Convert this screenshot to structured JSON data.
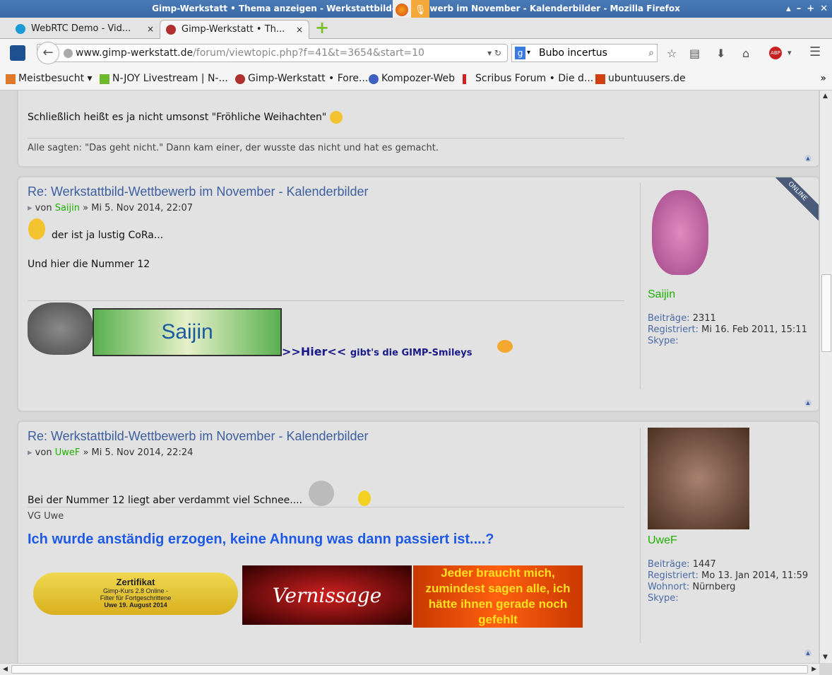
{
  "window": {
    "title": "Gimp-Werkstatt • Thema anzeigen - Werkstattbild-Wettbewerb im November - Kalenderbilder - Mozilla Firefox",
    "controls": [
      "▴",
      "–",
      "+",
      "✕"
    ]
  },
  "tabs": [
    {
      "label": "WebRTC Demo - Vid...",
      "close": "×"
    },
    {
      "label": "Gimp-Werkstatt • Th...",
      "close": "×"
    }
  ],
  "new_tab": "+",
  "nav": {
    "url_domain": "www.gimp-werkstatt.de",
    "url_path": "/forum/viewtopic.php?f=41&t=3654&start=10",
    "search_value": "Bubo incertus"
  },
  "bookmarks": [
    {
      "label": "Meistbesucht ▾",
      "color": "#e07a2a"
    },
    {
      "label": "N-JOY Livestream | N-...",
      "color": "#6cb92b"
    },
    {
      "label": "Gimp-Werkstatt • Fore...",
      "color": "#b03030"
    },
    {
      "label": "Kompozer-Web",
      "color": "#4060c0"
    },
    {
      "label": "Scribus Forum • Die d...",
      "color": "#d02020"
    },
    {
      "label": "ubuntuusers.de",
      "color": "#d04010"
    }
  ],
  "bookmarks_more": "»",
  "post0": {
    "text": "Schließlich heißt es ja nicht umsonst \"Fröhliche Weihachten\"",
    "signature": "Alle sagten: \"Das geht nicht.\" Dann kam einer, der wusste das nicht und hat es gemacht."
  },
  "post1": {
    "title": "Re: Werkstattbild-Wettbewerb im November - Kalenderbilder",
    "by": "von",
    "author": "Saijin",
    "date": "» Mi 5. Nov 2014, 22:07",
    "line1": "der ist ja lustig CoRa...",
    "line2": "Und hier die Nummer 12",
    "sig_banner": "Saijin",
    "sig_link": ">>Hier<<",
    "sig_text": "gibt's die GIMP-Smileys",
    "online": "ONLINE",
    "profile": {
      "name": "Saijin",
      "posts_label": "Beiträge:",
      "posts": "2311",
      "reg_label": "Registriert:",
      "reg": "Mi 16. Feb 2011, 15:11",
      "skype_label": "Skype:"
    }
  },
  "post2": {
    "title": "Re: Werkstattbild-Wettbewerb im November - Kalenderbilder",
    "by": "von",
    "author": "UweF",
    "date": "» Mi 5. Nov 2014, 22:24",
    "line1": "Bei der Nummer 12 liegt aber verdammt viel Schnee....",
    "sig1": "VG Uwe",
    "sig2": "Ich wurde anständig erzogen, keine Ahnung was dann passiert ist....?",
    "cert": {
      "title": "Zertifikat",
      "line1": "Gimp-Kurs 2.8 Online -",
      "line2": "Filter für Fortgeschrittene",
      "line3": "Uwe   19. August 2014"
    },
    "vernissage": "Vernissage",
    "quote": "Jeder braucht mich, zumindest sagen alle, ich hätte ihnen gerade noch gefehlt",
    "profile": {
      "name": "UweF",
      "posts_label": "Beiträge:",
      "posts": "1447",
      "reg_label": "Registriert:",
      "reg": "Mo 13. Jan 2014, 11:59",
      "loc_label": "Wohnort:",
      "loc": "Nürnberg",
      "skype_label": "Skype:"
    }
  }
}
